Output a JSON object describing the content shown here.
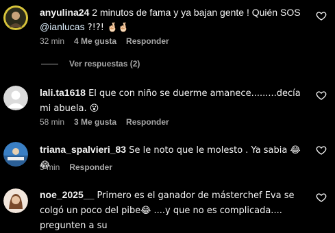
{
  "comments": [
    {
      "username": "anyulina24",
      "text_before": " 2 minutos de fama y ya bajan gente ! Quién SOS ",
      "mention": "@ianlucas",
      "text_after": " ?!?! 🤞🏻🤞🏻",
      "time": "32 min",
      "likes": "4 Me gusta",
      "reply": "Responder",
      "view_replies": "Ver respuestas (2)"
    },
    {
      "username": "lali.ta1618",
      "text": " El que con niño se duerme amanece.........decía mi abuela. 😮",
      "time": "58 min",
      "likes": "3 Me gusta",
      "reply": "Responder"
    },
    {
      "username": "triana_spalvieri_83",
      "text": " Se le noto que le molesto . Ya sabia 😂 😂",
      "time": "5 min",
      "reply": "Responder"
    },
    {
      "username": "noe_2025__",
      "text": " Primero es el ganador de másterchef Eva se colgó un poco del pibe😂 ....y que no es complicada.... pregunten a su"
    }
  ],
  "icons": {
    "heart": "heart-outline-icon",
    "avatar_default": "default-avatar-icon"
  },
  "colors": {
    "background": "#000000",
    "text": "#f5f5f5",
    "secondary": "#a8a8a8",
    "mention": "#e0f1ff"
  }
}
